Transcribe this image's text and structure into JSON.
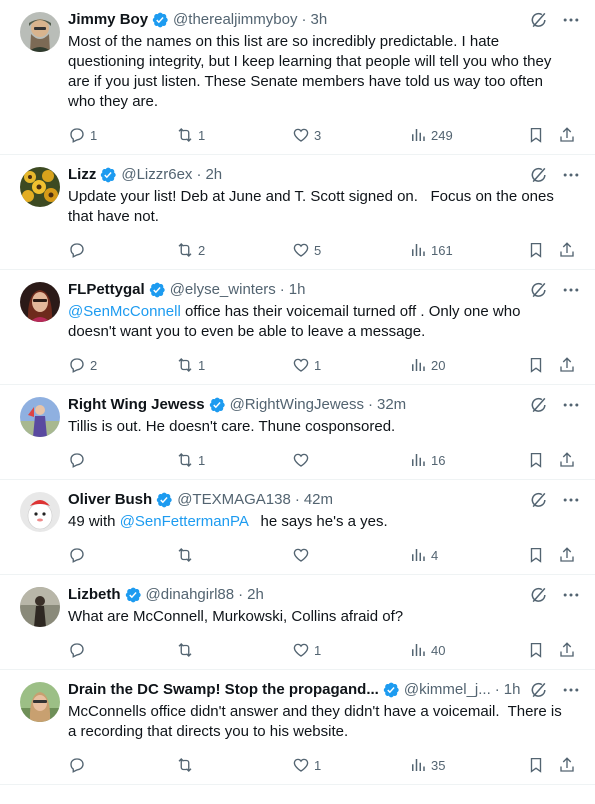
{
  "tweets": [
    {
      "name": "Jimmy Boy",
      "handle": "@therealjimmyboy",
      "time": "3h",
      "body": "Most of the names on this list are so incredibly predictable. I hate questioning integrity, but I keep learning that people will tell you who they are if you just listen. These Senate members have told us way too often who they are.",
      "replies": "1",
      "retweets": "1",
      "likes": "3",
      "views": "249",
      "avatar_color": "#8a8f8a"
    },
    {
      "name": "Lizz",
      "handle": "@Lizzr6ex",
      "time": "2h",
      "body": "Update your list! Deb at June and T. Scott signed on.   Focus on the ones that have not.",
      "replies": "",
      "retweets": "2",
      "likes": "5",
      "views": "161",
      "avatar_color": "#c9a21a"
    },
    {
      "name": "FLPettygal",
      "handle": "@elyse_winters",
      "time": "1h",
      "mention": "@SenMcConnell",
      "body": " office has their voicemail turned off . Only one who doesn't want you to even be able to leave a message.",
      "replies": "2",
      "retweets": "1",
      "likes": "1",
      "views": "20",
      "avatar_color": "#7a3b2e"
    },
    {
      "name": "Right Wing Jewess",
      "handle": "@RightWingJewess",
      "time": "32m",
      "body": "Tillis is out. He doesn't care. Thune cosponsored.",
      "replies": "",
      "retweets": "1",
      "likes": "",
      "views": "16",
      "avatar_color": "#5a7bbf"
    },
    {
      "name": "Oliver Bush",
      "handle": "@TEXMAGA138",
      "time": "42m",
      "body_prefix": "49 with ",
      "mention": "@SenFettermanPA",
      "body": "   he says he's a yes.",
      "replies": "",
      "retweets": "",
      "likes": "",
      "views": "4",
      "avatar_color": "#d9d9d9"
    },
    {
      "name": "Lizbeth",
      "handle": "@dinahgirl88",
      "time": "2h",
      "body": "What are McConnell, Murkowski, Collins afraid of?",
      "replies": "",
      "retweets": "",
      "likes": "1",
      "views": "40",
      "avatar_color": "#6b6b5e"
    },
    {
      "name": "Drain the DC Swamp! Stop the propagand...",
      "handle": "@kimmel_j...",
      "time": "1h",
      "body": "McConnells office didn't answer and they didn't have a voicemail.  There is a recording that directs you to his website.",
      "replies": "",
      "retweets": "",
      "likes": "1",
      "views": "35",
      "avatar_color": "#7fa06a"
    }
  ],
  "ui": {
    "dot": "·"
  },
  "icons": [
    "verified-badge-icon",
    "grok-icon",
    "more-icon",
    "reply-icon",
    "retweet-icon",
    "like-icon",
    "views-icon",
    "bookmark-icon",
    "share-icon"
  ],
  "colors": {
    "accent": "#1d9bf0",
    "muted": "#536471",
    "text": "#0f1419",
    "divider": "#eff3f4"
  }
}
